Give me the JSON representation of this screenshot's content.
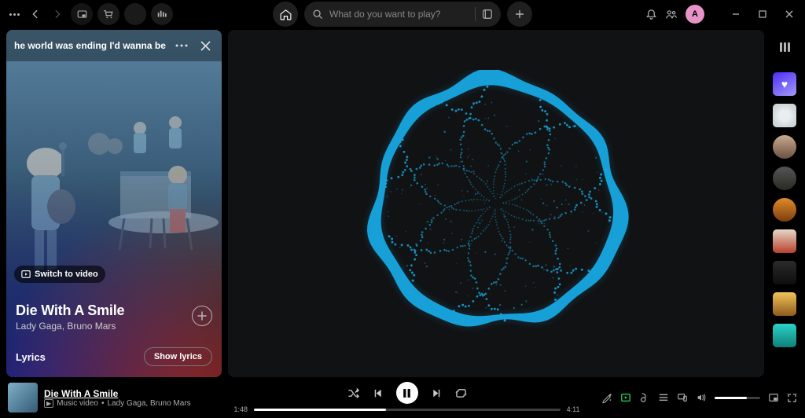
{
  "topbar": {
    "search_placeholder": "What do you want to play?",
    "avatar_letter": "A"
  },
  "now_playing_panel": {
    "header_scroll_text": "he world was ending I'd wanna be next t",
    "switch_label": "Switch to video",
    "song_title": "Die With A Smile",
    "artists": "Lady Gaga, Bruno Mars",
    "lyrics_label": "Lyrics",
    "show_lyrics_label": "Show lyrics"
  },
  "right_rail": {
    "items": [
      {
        "name": "liked-songs",
        "bg": "linear-gradient(150deg,#4b2df5,#a39af7)"
      },
      {
        "name": "playlist-1",
        "bg": "radial-gradient(circle,#e9eef0 30%,#cfd6d9 70%)"
      },
      {
        "name": "artist-1",
        "bg": "linear-gradient(#caa98e,#6b5141)"
      },
      {
        "name": "album-1",
        "bg": "linear-gradient(#555,#2a2a23)"
      },
      {
        "name": "artist-2",
        "bg": "linear-gradient(#e08a2a,#7b3e10)"
      },
      {
        "name": "artist-3",
        "bg": "linear-gradient(#e5d8c8,#b8402b)"
      },
      {
        "name": "album-2",
        "bg": "linear-gradient(#2a2a2a,#0e0e0e)"
      },
      {
        "name": "album-3",
        "bg": "linear-gradient(#f2c45a,#8e5a1c)"
      },
      {
        "name": "album-4",
        "bg": "linear-gradient(#2bd3c9,#0f7f78)"
      }
    ]
  },
  "player": {
    "song_title": "Die With A Smile",
    "sub_prefix": "Music video",
    "artists_line": "Lady Gaga, Bruno Mars",
    "elapsed": "1:48",
    "total": "4:11",
    "progress_pct": 43,
    "volume_pct": 70
  },
  "colors": {
    "viz_primary": "#18a7e0",
    "accent_green": "#1ed760"
  }
}
